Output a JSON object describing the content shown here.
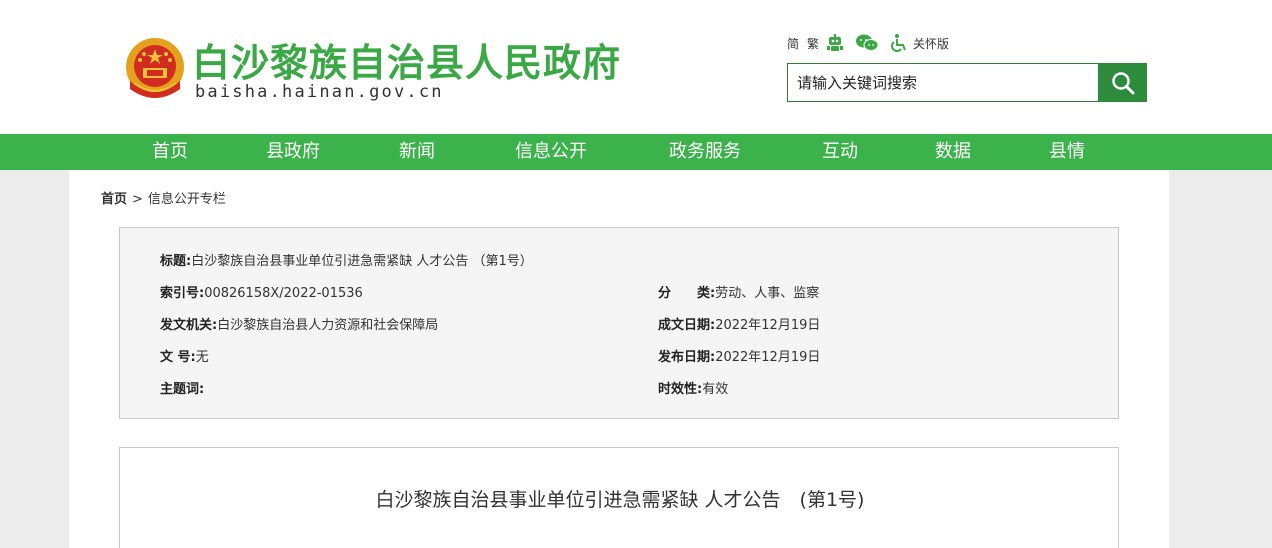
{
  "header": {
    "site_title": "白沙黎族自治县人民政府",
    "site_domain": "baisha.hainan.gov.cn",
    "tools": {
      "simplified": "简",
      "traditional": "繁",
      "care_mode": "关怀版"
    },
    "search": {
      "placeholder": "请输入关键词搜索"
    }
  },
  "nav": {
    "items": [
      {
        "label": "首页"
      },
      {
        "label": "县政府"
      },
      {
        "label": "新闻"
      },
      {
        "label": "信息公开"
      },
      {
        "label": "政务服务"
      },
      {
        "label": "互动"
      },
      {
        "label": "数据"
      },
      {
        "label": "县情"
      }
    ]
  },
  "breadcrumb": {
    "home": "首页",
    "separator": ">",
    "current": "信息公开专栏"
  },
  "info": {
    "title_label": "标题:",
    "title_value": "白沙黎族自治县事业单位引进急需紧缺 人才公告 （第1号）",
    "index_label": "索引号:",
    "index_value": "00826158X/2022-01536",
    "category_label": "分　　类:",
    "category_value": "劳动、人事、监察",
    "issuer_label": "发文机关:",
    "issuer_value": "白沙黎族自治县人力资源和社会保障局",
    "created_label": "成文日期:",
    "created_value": "2022年12月19日",
    "docno_label": "文 号:",
    "docno_value": "无",
    "published_label": "发布日期:",
    "published_value": "2022年12月19日",
    "keywords_label": "主题词:",
    "keywords_value": "",
    "validity_label": "时效性:",
    "validity_value": "有效"
  },
  "article": {
    "title": "白沙黎族自治县事业单位引进急需紧缺 人才公告　(第1号)"
  },
  "colors": {
    "brand_green": "#3aa845",
    "nav_green": "#3cb24a",
    "button_green": "#2e8b3c"
  },
  "icons": {
    "emblem": "national-emblem-icon",
    "accessibility_robot": "robot-icon",
    "wechat": "wechat-icon",
    "wheelchair": "wheelchair-icon",
    "search": "search-icon"
  }
}
